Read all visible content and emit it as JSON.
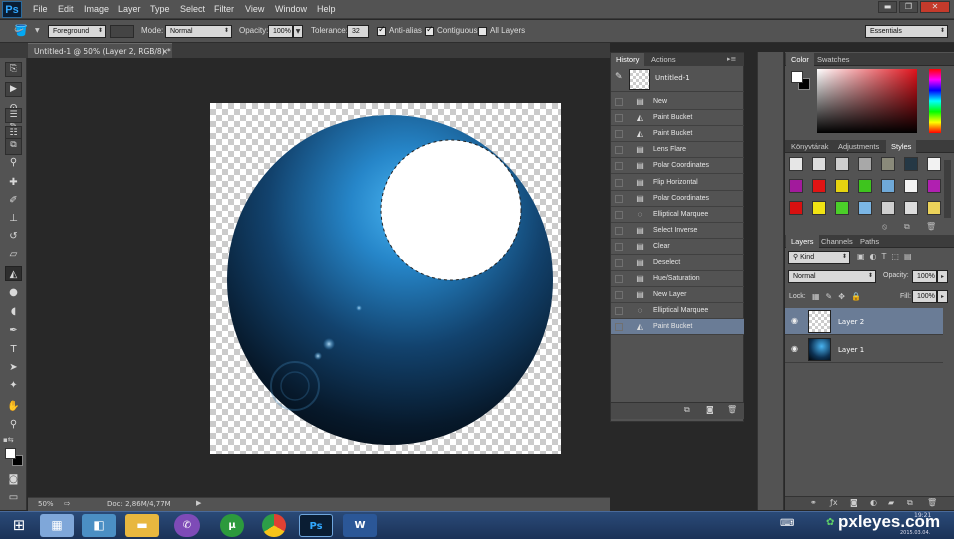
{
  "app": {
    "logo": "Ps",
    "document_tab": "Untitled-1 @ 50% (Layer 2, RGB/8) *",
    "close_glyph": "×"
  },
  "menu": [
    "File",
    "Edit",
    "Image",
    "Layer",
    "Type",
    "Select",
    "Filter",
    "View",
    "Window",
    "Help"
  ],
  "window_controls": {
    "minimize": "▬",
    "restore": "❐",
    "close": "✕"
  },
  "options": {
    "fill_source": "Foreground",
    "mode_label": "Mode:",
    "mode_value": "Normal",
    "opacity_label": "Opacity:",
    "opacity_value": "100%",
    "tolerance_label": "Tolerance:",
    "tolerance_value": "32",
    "anti_alias": "Anti-alias",
    "contiguous": "Contiguous",
    "all_layers": "All Layers",
    "workspace": "Essentials"
  },
  "status": {
    "zoom": "50%",
    "doc": "Doc: 2,86M/4,77M"
  },
  "history": {
    "tabs": [
      "History",
      "Actions"
    ],
    "snapshot": "Untitled-1",
    "items": [
      {
        "label": "New",
        "icon": "doc-icon"
      },
      {
        "label": "Paint Bucket",
        "icon": "bucket-icon"
      },
      {
        "label": "Paint Bucket",
        "icon": "bucket-icon"
      },
      {
        "label": "Lens Flare",
        "icon": "doc-icon"
      },
      {
        "label": "Polar Coordinates",
        "icon": "doc-icon"
      },
      {
        "label": "Flip Horizontal",
        "icon": "doc-icon"
      },
      {
        "label": "Polar Coordinates",
        "icon": "doc-icon"
      },
      {
        "label": "Elliptical Marquee",
        "icon": "ellipse-icon"
      },
      {
        "label": "Select Inverse",
        "icon": "doc-icon"
      },
      {
        "label": "Clear",
        "icon": "doc-icon"
      },
      {
        "label": "Deselect",
        "icon": "doc-icon"
      },
      {
        "label": "Hue/Saturation",
        "icon": "doc-icon"
      },
      {
        "label": "New Layer",
        "icon": "doc-icon"
      },
      {
        "label": "Elliptical Marquee",
        "icon": "ellipse-icon"
      },
      {
        "label": "Paint Bucket",
        "icon": "bucket-icon"
      }
    ]
  },
  "color_panel": {
    "tabs": [
      "Color",
      "Swatches"
    ]
  },
  "styles_panel": {
    "tabs": [
      "Könyvtárak",
      "Adjustments",
      "Styles"
    ]
  },
  "layers_panel": {
    "tabs": [
      "Layers",
      "Channels",
      "Paths"
    ],
    "filter": "Kind",
    "blend": "Normal",
    "opacity_label": "Opacity:",
    "opacity_value": "100%",
    "lock_label": "Lock:",
    "fill_label": "Fill:",
    "fill_value": "100%",
    "layers": [
      "Layer 2",
      "Layer 1"
    ]
  },
  "taskbar": {
    "clock": "19:21",
    "date": "2015.03.04.",
    "watermark": "pxleyes.com"
  },
  "colors": {
    "accent": "#31a8ff",
    "selection": "#6a7c96",
    "sphere": "#1f7fc0"
  }
}
